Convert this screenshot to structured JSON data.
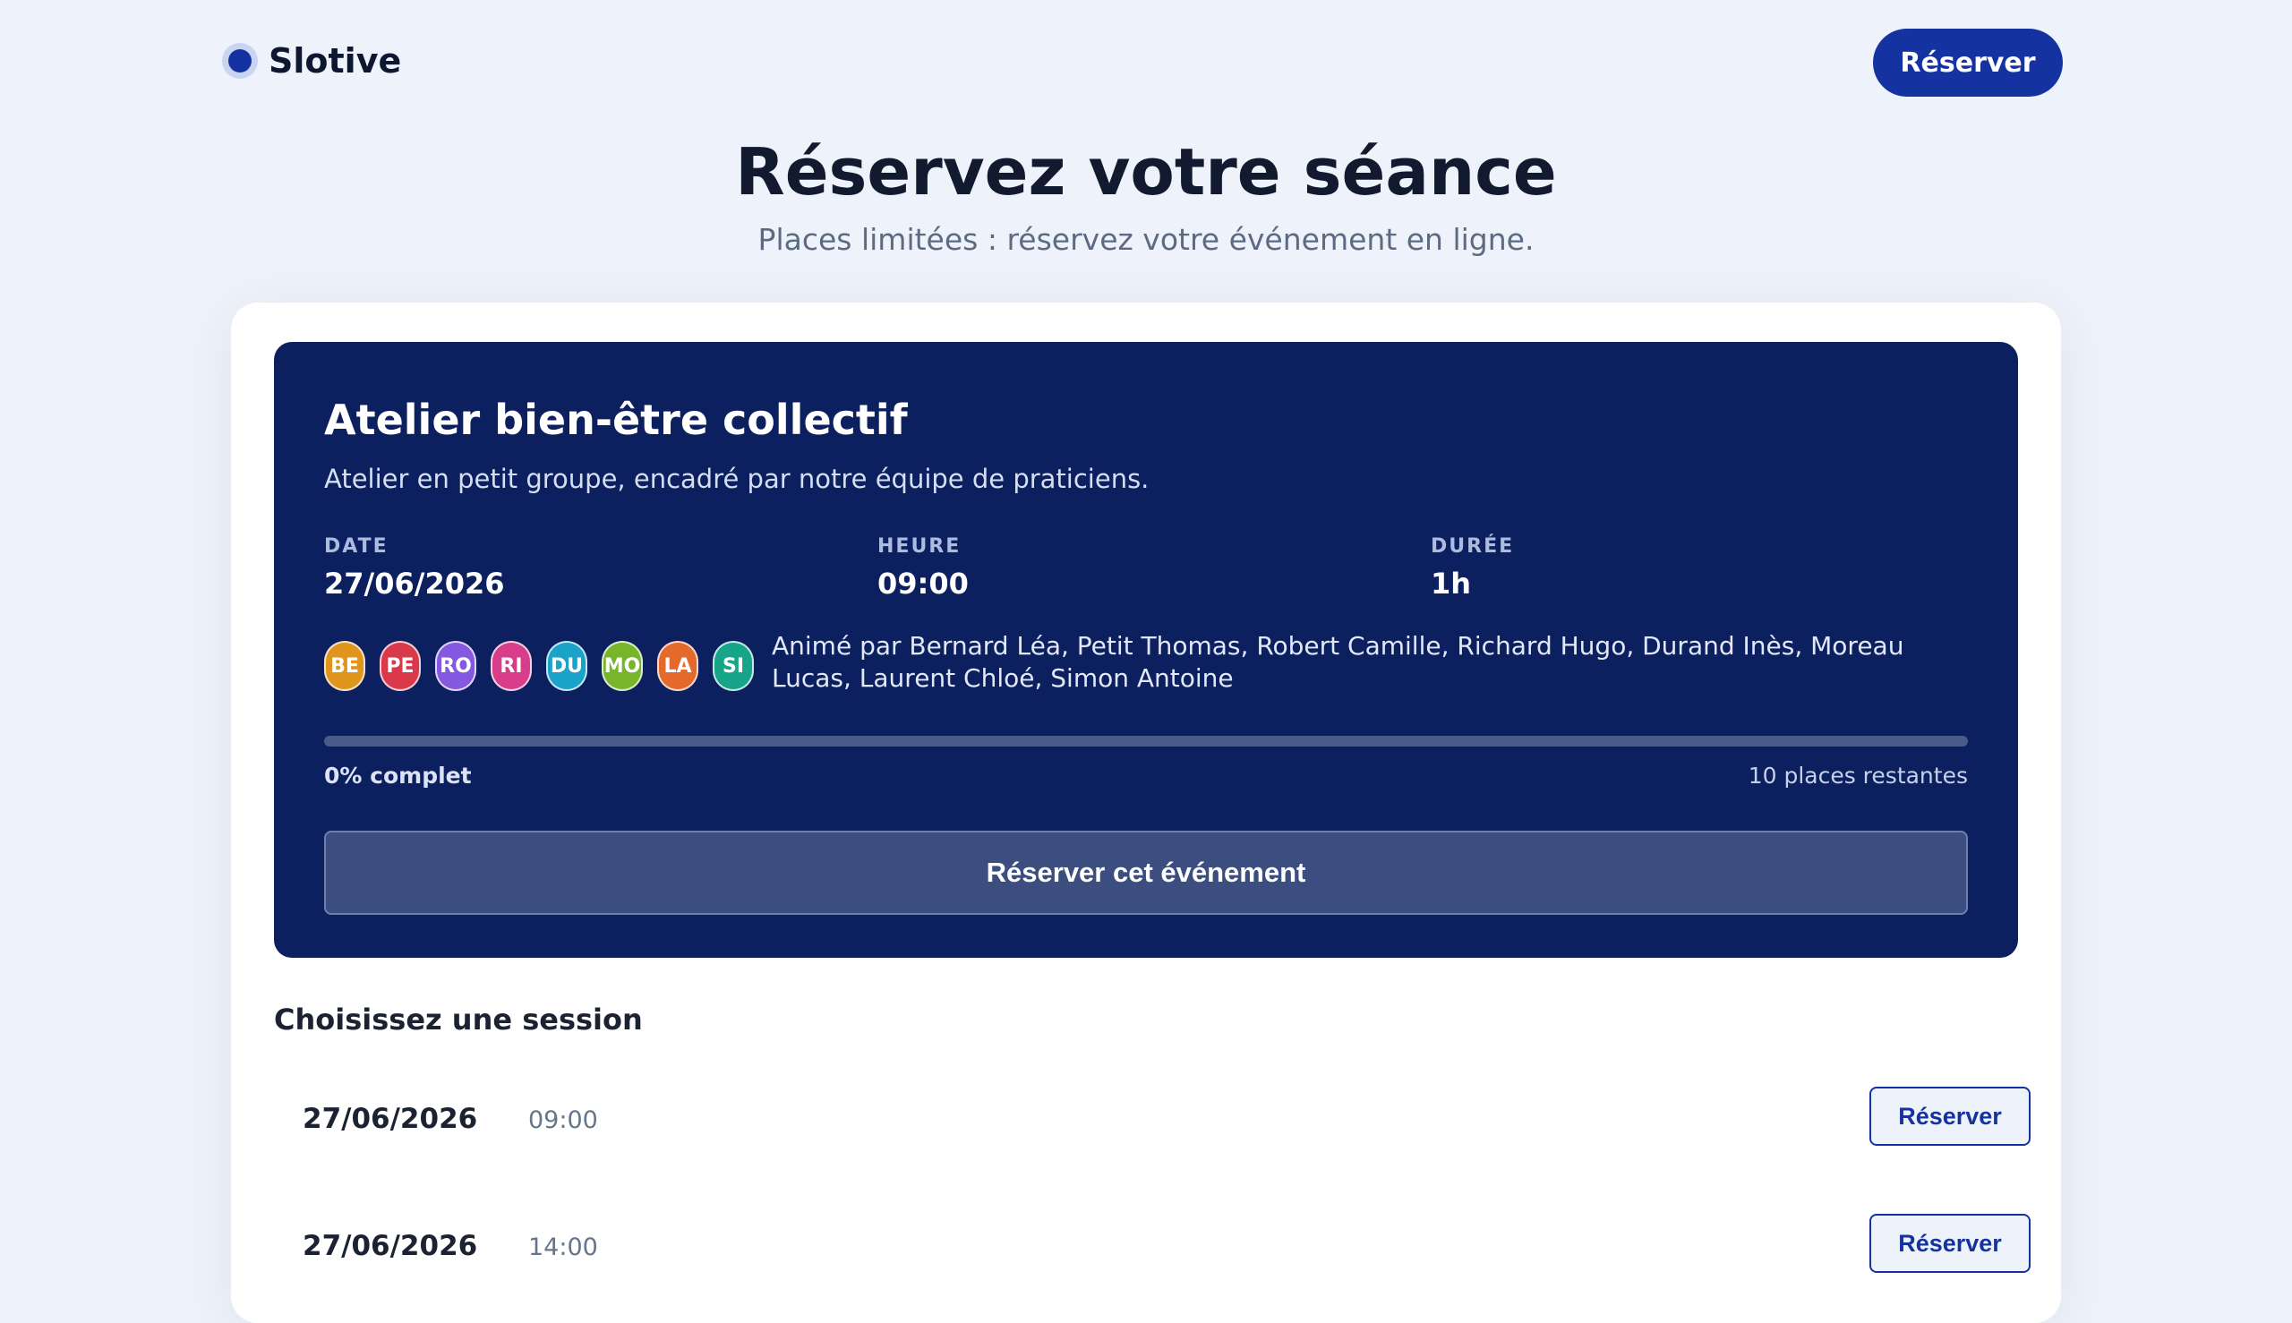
{
  "header": {
    "brand": "Slotive",
    "cta_label": "Réserver"
  },
  "hero": {
    "title": "Réservez votre séance",
    "subtitle": "Places limitées : réservez votre événement en ligne."
  },
  "event": {
    "title": "Atelier bien-être collectif",
    "description": "Atelier en petit groupe, encadré par notre équipe de praticiens.",
    "meta": [
      {
        "label": "DATE",
        "value": "27/06/2026"
      },
      {
        "label": "HEURE",
        "value": "09:00"
      },
      {
        "label": "DURÉE",
        "value": "1h"
      }
    ],
    "avatars": [
      {
        "initials": "BE",
        "color": "#e0951c"
      },
      {
        "initials": "PE",
        "color": "#d9394a"
      },
      {
        "initials": "RO",
        "color": "#8458e0"
      },
      {
        "initials": "RI",
        "color": "#d83d8a"
      },
      {
        "initials": "DU",
        "color": "#1aa2c9"
      },
      {
        "initials": "MO",
        "color": "#77b52a"
      },
      {
        "initials": "LA",
        "color": "#e5692b"
      },
      {
        "initials": "SI",
        "color": "#17a58a"
      }
    ],
    "hosts_text": "Animé par Bernard Léa, Petit Thomas, Robert Camille, Richard Hugo, Durand Inès, Moreau Lucas, Laurent Chloé, Simon Antoine",
    "progress_percent": 0,
    "progress_label": "0% complet",
    "remaining_label": "10 places restantes",
    "cta_label": "Réserver cet événement"
  },
  "sessions": {
    "title": "Choisissez une session",
    "items": [
      {
        "date": "27/06/2026",
        "time": "09:00",
        "button_label": "Réserver"
      },
      {
        "date": "27/06/2026",
        "time": "14:00",
        "button_label": "Réserver"
      }
    ]
  }
}
